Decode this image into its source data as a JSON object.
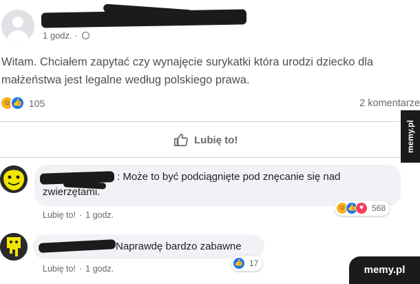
{
  "post": {
    "time": "1 godz. ·",
    "text": "Witam. Chciałem zapytać czy wynajęcie surykatki która urodzi dziecko dla małżeństwa jest legalne według polskiego prawa.",
    "reactions_count": "105",
    "comments_count": "2 komentarze",
    "like_label": "Lubię to!"
  },
  "comments": [
    {
      "text": ": Może to być podciągnięte pod znęcanie się nad zwierzętami.",
      "like": "Lubię to!",
      "time": "1 godz.",
      "reaction_count": "568"
    },
    {
      "text": "Naprawdę bardzo zabawne",
      "like": "Lubię to!",
      "time": "1 godz.",
      "reaction_count": "17"
    }
  ],
  "watermark": "memy.pl",
  "colors": {
    "like_blue": "#1877f2",
    "haha_yellow": "#f7b125",
    "love_red": "#f33e58",
    "bubble_bg": "#f0f2f5"
  }
}
